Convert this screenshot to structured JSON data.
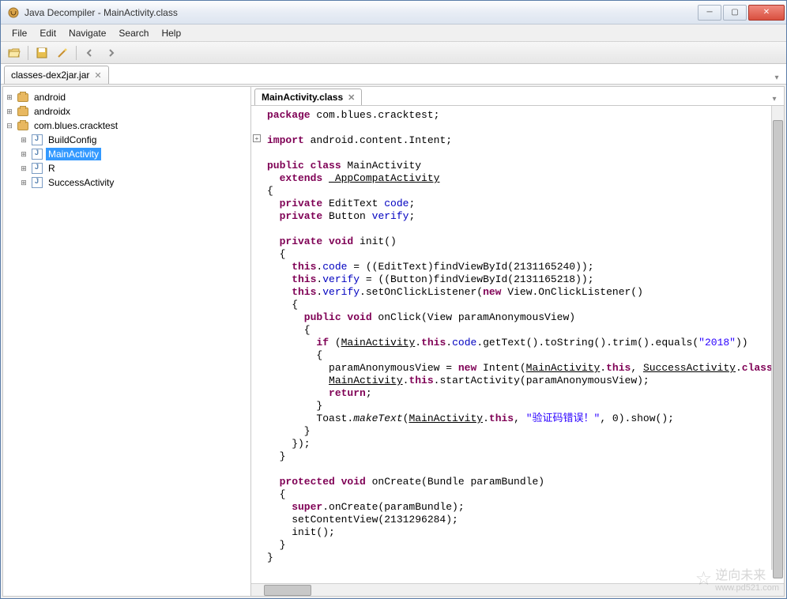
{
  "window": {
    "title": "Java Decompiler - MainActivity.class"
  },
  "menu": {
    "file": "File",
    "edit": "Edit",
    "navigate": "Navigate",
    "search": "Search",
    "help": "Help"
  },
  "jar_tab": {
    "label": "classes-dex2jar.jar"
  },
  "tree": {
    "pkg_android": "android",
    "pkg_androidx": "androidx",
    "pkg_app": "com.blues.cracktest",
    "items": {
      "build": "BuildConfig",
      "main": "MainActivity",
      "r": "R",
      "success": "SuccessActivity"
    }
  },
  "code_tab": {
    "label": "MainActivity.class"
  },
  "code": {
    "l1a": "package",
    "l1b": " com.blues.cracktest;",
    "l3a": "import",
    "l3b": " android.content.Intent;",
    "l5a": "public class",
    "l5b": " MainActivity",
    "l6a": "  extends",
    "l6b": " AppCompatActivity",
    "l7": "{",
    "l8a": "  private",
    "l8b": " EditText ",
    "l8c": "code",
    "l8d": ";",
    "l9a": "  private",
    "l9b": " Button ",
    "l9c": "verify",
    "l9d": ";",
    "l11a": "  private void",
    "l11b": " init()",
    "l12": "  {",
    "l13a": "    this",
    "l13b": ".",
    "l13c": "code",
    "l13d": " = ((EditText)findViewById(2131165240));",
    "l14a": "    this",
    "l14b": ".",
    "l14c": "verify",
    "l14d": " = ((Button)findViewById(2131165218));",
    "l15a": "    this",
    "l15b": ".",
    "l15c": "verify",
    "l15d": ".setOnClickListener(",
    "l15e": "new",
    "l15f": " View.OnClickListener()",
    "l16": "    {",
    "l17a": "      public void",
    "l17b": " onClick(View paramAnonymousView)",
    "l18": "      {",
    "l19a": "        if",
    "l19b": " (",
    "l19c": "MainActivity",
    "l19d": ".",
    "l19e": "this",
    "l19f": ".",
    "l19g": "code",
    "l19h": ".getText().toString().trim().equals(",
    "l19i": "\"2018\"",
    "l19j": "))",
    "l20": "        {",
    "l21a": "          paramAnonymousView = ",
    "l21b": "new",
    "l21c": " Intent(",
    "l21d": "MainActivity",
    "l21e": ".",
    "l21f": "this",
    "l21g": ", ",
    "l21h": "SuccessActivity",
    "l21i": ".",
    "l21j": "class",
    "l21k": ");",
    "l22a": "          ",
    "l22b": "MainActivity",
    "l22c": ".",
    "l22d": "this",
    "l22e": ".startActivity(paramAnonymousView);",
    "l23a": "          return",
    "l23b": ";",
    "l24": "        }",
    "l25a": "        Toast.",
    "l25b": "makeText",
    "l25c": "(",
    "l25d": "MainActivity",
    "l25e": ".",
    "l25f": "this",
    "l25g": ", ",
    "l25h": "\"验证码错误！\"",
    "l25i": ", 0).show();",
    "l26": "      }",
    "l27": "    });",
    "l28": "  }",
    "l30a": "  protected void",
    "l30b": " onCreate(Bundle paramBundle)",
    "l31": "  {",
    "l32a": "    super",
    "l32b": ".onCreate(paramBundle);",
    "l33": "    setContentView(2131296284);",
    "l34": "    init();",
    "l35": "  }",
    "l36": "}"
  },
  "watermark": {
    "text1": "逆向未来",
    "text2": "www.pd521.com"
  }
}
